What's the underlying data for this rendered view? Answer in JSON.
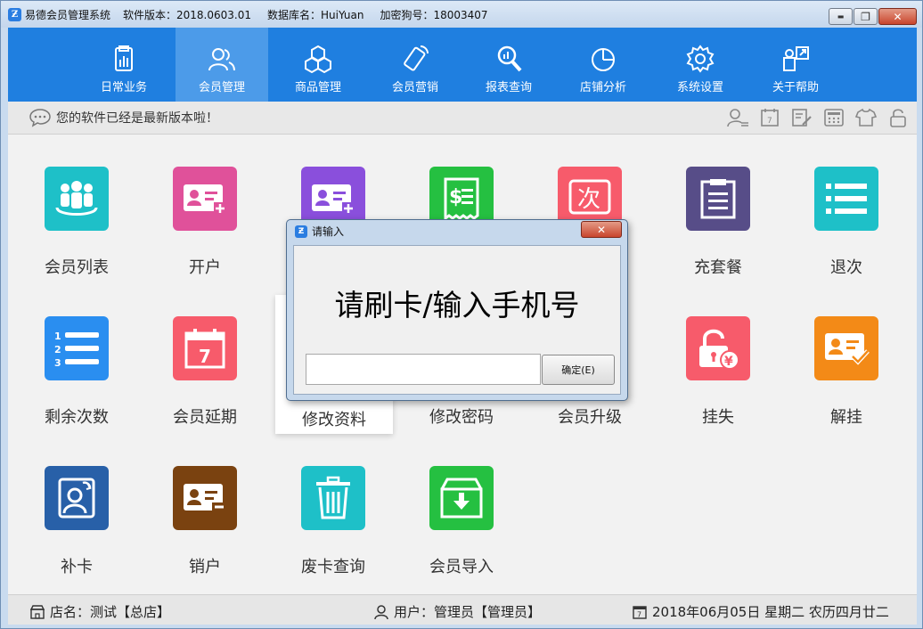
{
  "window": {
    "app_name": "易德会员管理系统",
    "version": "软件版本：2018.0603.01",
    "database": "数据库名：HuiYuan",
    "dongle": "加密狗号：18003407",
    "minimize_label": "▬",
    "restore_label": "❐",
    "close_label": "✕"
  },
  "nav": {
    "items": [
      {
        "label": "日常业务",
        "icon": "clipboard-chart-icon"
      },
      {
        "label": "会员管理",
        "icon": "users-icon",
        "active": true
      },
      {
        "label": "商品管理",
        "icon": "cubes-icon"
      },
      {
        "label": "会员营销",
        "icon": "phone-icon"
      },
      {
        "label": "报表查询",
        "icon": "magnifier-chart-icon"
      },
      {
        "label": "店铺分析",
        "icon": "pie-chart-icon"
      },
      {
        "label": "系统设置",
        "icon": "gear-icon"
      },
      {
        "label": "关于帮助",
        "icon": "help-icon"
      }
    ]
  },
  "notice": {
    "text": "您的软件已经是最新版本啦！"
  },
  "tiles": [
    {
      "label": "会员列表",
      "color": "#1ec0c8",
      "icon": "people-group-icon"
    },
    {
      "label": "开户",
      "color": "#e0519a",
      "icon": "id-card-plus-icon"
    },
    {
      "label": "",
      "color": "#8a4fdc",
      "icon": "id-card-plus-icon"
    },
    {
      "label": "",
      "color": "#25c041",
      "icon": "receipt-dollar-icon"
    },
    {
      "label": "",
      "color": "#f75b6b",
      "icon": "times-card-icon",
      "glyph": "次"
    },
    {
      "label": "充套餐",
      "color": "#574d88",
      "icon": "package-icon"
    },
    {
      "label": "退次",
      "color": "#1ec0c8",
      "icon": "list-icon"
    },
    {
      "label": "剩余次数",
      "color": "#2a8ef0",
      "icon": "numbered-list-icon"
    },
    {
      "label": "会员延期",
      "color": "#f75b6b",
      "icon": "calendar-icon",
      "glyph": "7"
    },
    {
      "label": "修改资料",
      "color": "#ffffff",
      "icon": "edit-profile-icon"
    },
    {
      "label": "修改密码",
      "color": "#ffffff",
      "icon": "password-icon"
    },
    {
      "label": "会员升级",
      "color": "#ffffff",
      "icon": "upgrade-icon"
    },
    {
      "label": "挂失",
      "color": "#f75b6b",
      "icon": "lock-yen-icon"
    },
    {
      "label": "解挂",
      "color": "#f38a17",
      "icon": "id-card-check-icon"
    },
    {
      "label": "补卡",
      "color": "#2860a8",
      "icon": "replace-card-icon"
    },
    {
      "label": "销户",
      "color": "#7a4210",
      "icon": "id-card-minus-icon"
    },
    {
      "label": "废卡查询",
      "color": "#1ec0c8",
      "icon": "trash-icon"
    },
    {
      "label": "会员导入",
      "color": "#25c041",
      "icon": "import-box-icon"
    }
  ],
  "status": {
    "store": "店名：测试【总店】",
    "user": "用户：管理员【管理员】",
    "date": "2018年06月05日 星期二 农历四月廿二"
  },
  "dialog": {
    "title": "请输入",
    "close_label": "✕",
    "prompt": "请刷卡/输入手机号",
    "input_value": "",
    "ok_label": "确定(E)"
  },
  "colors": {
    "nav_bg": "#1f7fe0",
    "nav_active": "#4c9be9"
  }
}
